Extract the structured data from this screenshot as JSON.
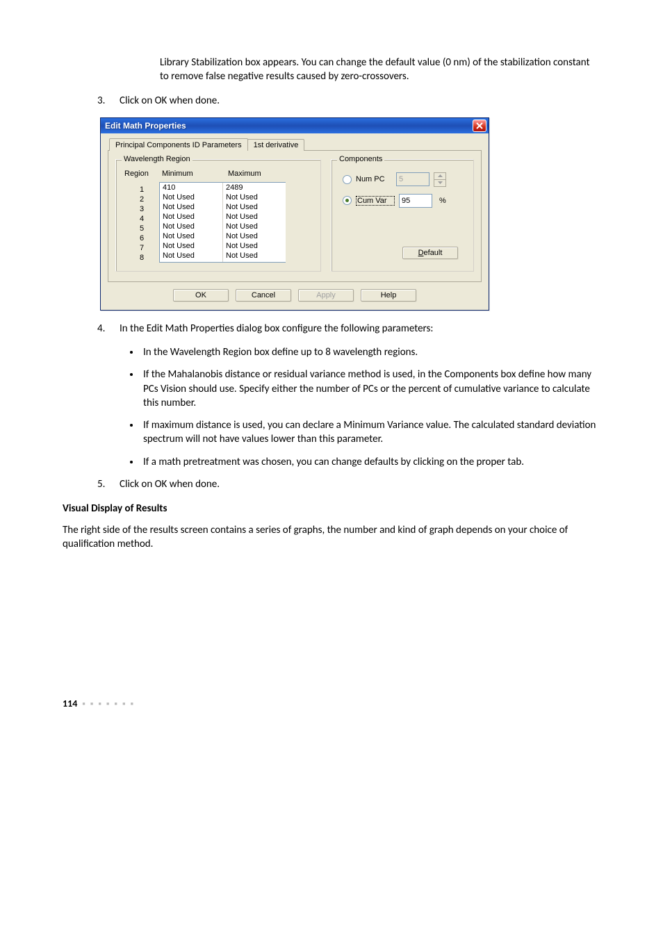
{
  "intro_paragraph": "Library Stabilization box appears. You can change the default value (0 nm) of the stabilization constant to remove false negative results caused by zero-crossovers.",
  "step3": {
    "num": "3.",
    "text": "Click on OK when done."
  },
  "dialog": {
    "title": "Edit Math Properties",
    "tabs": {
      "active": "Principal Components ID Parameters",
      "inactive": "1st derivative"
    },
    "wavelength": {
      "legend": "Wavelength Region",
      "headers": {
        "region": "Region",
        "min": "Minimum",
        "max": "Maximum"
      },
      "regions": [
        "1",
        "2",
        "3",
        "4",
        "5",
        "6",
        "7",
        "8"
      ],
      "min_vals": [
        "410",
        "Not Used",
        "Not Used",
        "Not Used",
        "Not Used",
        "Not Used",
        "Not Used",
        "Not Used"
      ],
      "max_vals": [
        "2489",
        "Not Used",
        "Not Used",
        "Not Used",
        "Not Used",
        "Not Used",
        "Not Used",
        "Not Used"
      ]
    },
    "components": {
      "legend": "Components",
      "numpc_label": "Num PC",
      "numpc_value": "5",
      "cumvar_label": "Cum Var",
      "cumvar_value": "95",
      "percent": "%",
      "default_btn": "Default"
    },
    "buttons": {
      "ok": "OK",
      "cancel": "Cancel",
      "apply": "Apply",
      "help": "Help"
    }
  },
  "step4": {
    "num": "4.",
    "text": "In the Edit Math Properties dialog box configure the following parameters:",
    "bullets": [
      "In the Wavelength Region box define up to 8 wavelength regions.",
      "If the Mahalanobis distance or residual variance method is used, in the Components box define how many PCs Vision should use. Specify either the number of PCs or the percent of cumulative variance to calculate this number.",
      "If maximum distance is used, you can declare a Minimum Variance value. The calculated standard deviation spectrum will not have values lower than this parameter.",
      "If a math pretreatment was chosen, you can change defaults by clicking on the proper tab."
    ]
  },
  "step5": {
    "num": "5.",
    "text": "Click on OK when done."
  },
  "heading": "Visual Display of Results",
  "body_after": "The right side of the results screen contains a series of graphs, the number and kind of graph depends on your choice of qualification method.",
  "footer": {
    "page": "114",
    "dots": "▪ ▪ ▪ ▪ ▪ ▪ ▪"
  }
}
